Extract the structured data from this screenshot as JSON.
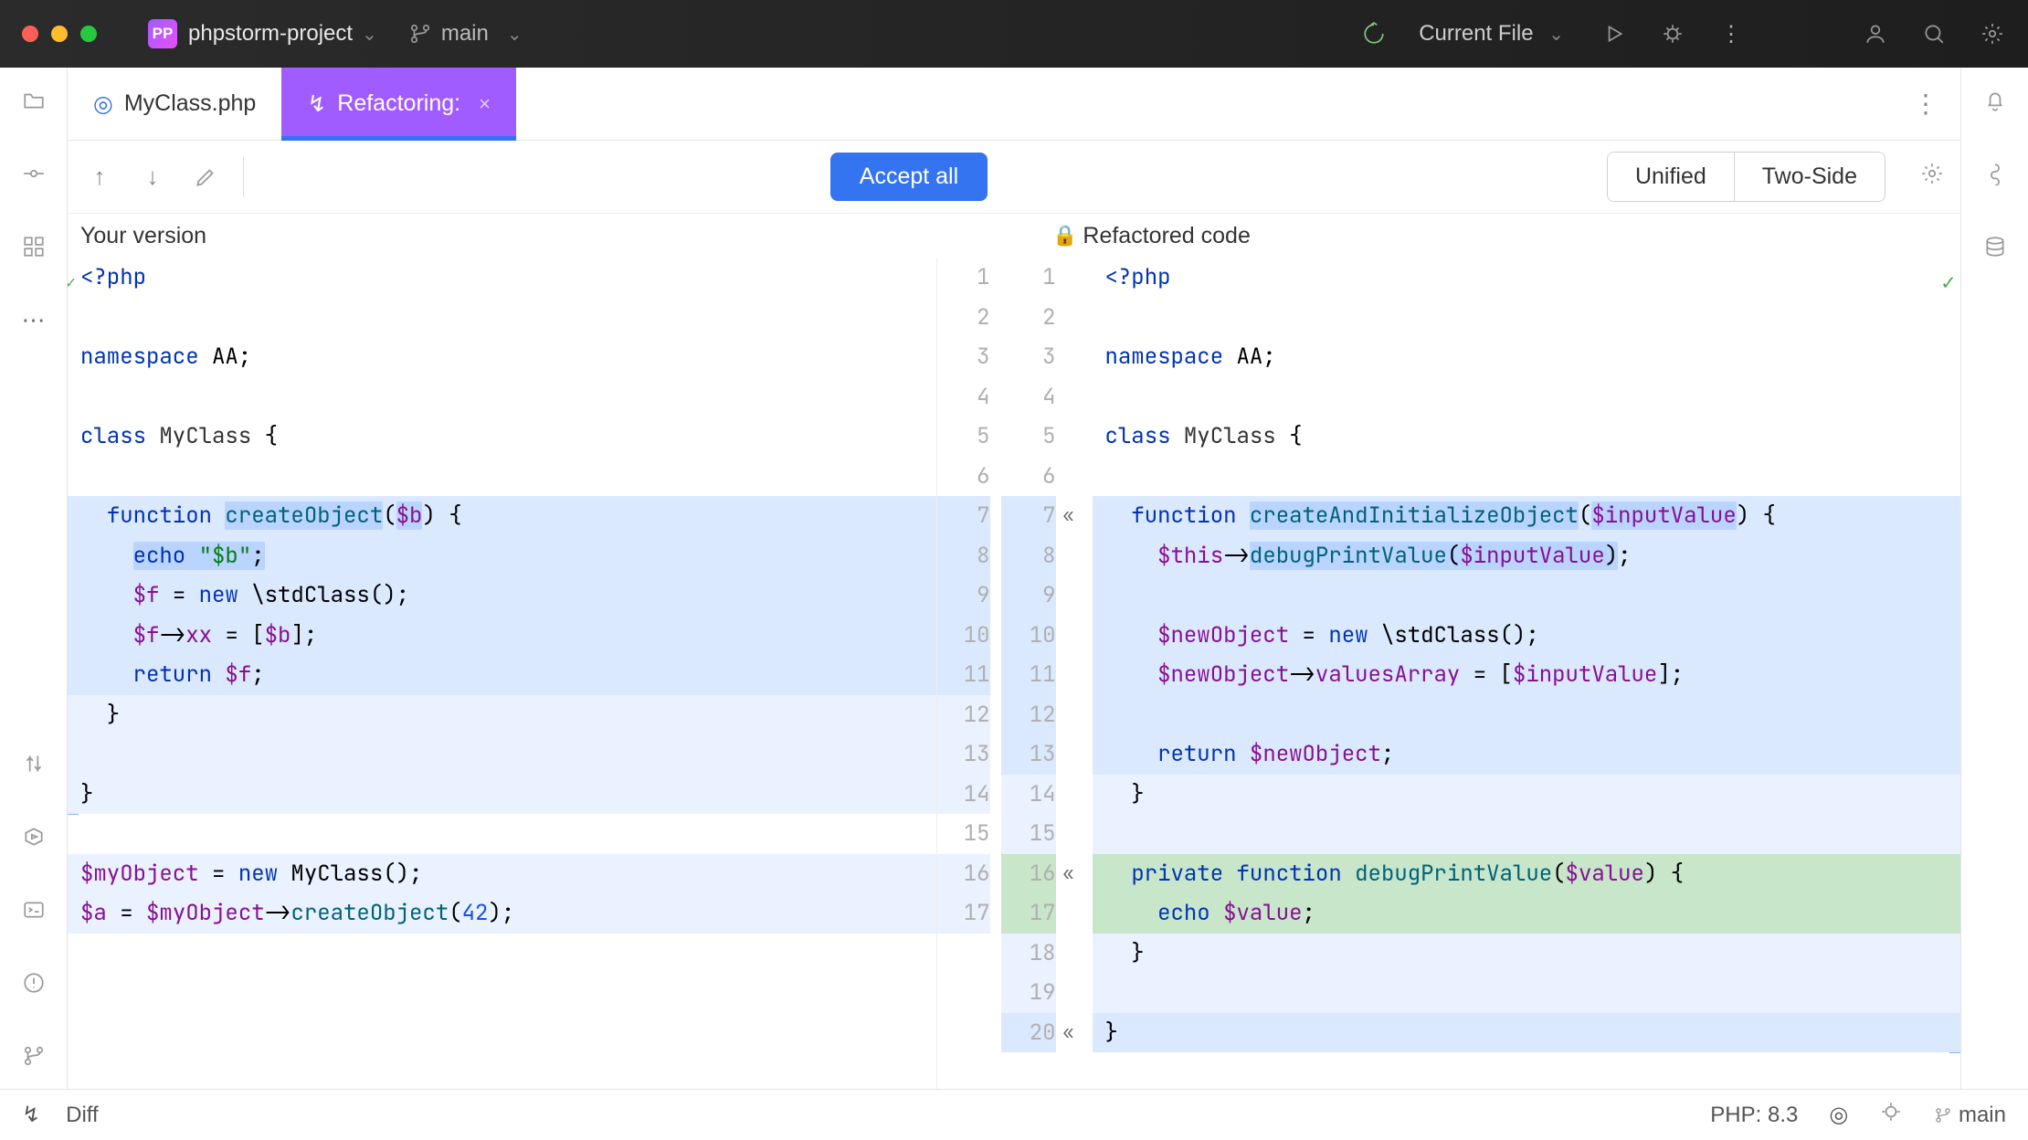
{
  "titlebar": {
    "project_name": "phpstorm-project",
    "branch_name": "main",
    "current_file_label": "Current File"
  },
  "tabs": {
    "file_tab": "MyClass.php",
    "refactor_tab": "Refactoring:"
  },
  "toolbar": {
    "accept_label": "Accept all",
    "view_unified": "Unified",
    "view_twoside": "Two-Side"
  },
  "diff_headers": {
    "left": "Your version",
    "right": "Refactored code"
  },
  "gutters_left": [
    "1",
    "2",
    "3",
    "4",
    "5",
    "6",
    "7",
    "8",
    "9",
    "10",
    "11",
    "12",
    "13",
    "14",
    "15",
    "16",
    "17"
  ],
  "gutters_right": [
    "1",
    "2",
    "3",
    "4",
    "5",
    "6",
    "7",
    "8",
    "9",
    "10",
    "11",
    "12",
    "13",
    "14",
    "15",
    "16",
    "17",
    "18",
    "19",
    "20"
  ],
  "left_code": [
    {
      "t": "<?php",
      "cls": "tag"
    },
    {
      "t": ""
    },
    {
      "t": "namespace AA;",
      "ns": true
    },
    {
      "t": ""
    },
    {
      "t": "class MyClass {",
      "classdecl": true
    },
    {
      "t": ""
    },
    {
      "t": "  function createObject($b) {",
      "hl": "blue",
      "fn": "createObject",
      "args": "$b",
      "w1": "createObject",
      "w2": "$b"
    },
    {
      "t": "    echo \"$b\";",
      "hl": "blue",
      "echo": true,
      "wordfull": true
    },
    {
      "t": "    $f = new \\stdClass();",
      "hl": "blue",
      "var1": "$f"
    },
    {
      "t": "    $f->xx = [$b];",
      "hl": "blue",
      "var1": "$f",
      "prop": "xx",
      "arr": "$b"
    },
    {
      "t": "    return $f;",
      "hl": "blue",
      "var1": "$f"
    },
    {
      "t": "  }",
      "hl": "lite"
    },
    {
      "t": "",
      "hl": "lite"
    },
    {
      "t": "}",
      "hl": "lite"
    },
    {
      "t": ""
    },
    {
      "t": "$myObject = new MyClass();",
      "hl": "lite",
      "var1": "$myObject"
    },
    {
      "t": "$a = $myObject->createObject(42);",
      "hl": "lite",
      "var1": "$a",
      "var2": "$myObject",
      "fn": "createObject",
      "num": "42"
    }
  ],
  "right_code": [
    {
      "t": "<?php",
      "cls": "tag"
    },
    {
      "t": ""
    },
    {
      "t": "namespace AA;",
      "ns": true
    },
    {
      "t": ""
    },
    {
      "t": "class MyClass {",
      "classdecl": true
    },
    {
      "t": ""
    },
    {
      "t": "  function createAndInitializeObject($inputValue) {",
      "hl": "blue",
      "fn": "createAndInitializeObject",
      "args": "$inputValue",
      "w1": "createAndInitializeObject",
      "w2": "$inputValue"
    },
    {
      "t": "    $this->debugPrintValue($inputValue);",
      "hl": "blue",
      "thiscall": true
    },
    {
      "t": "",
      "hl": "blue"
    },
    {
      "t": "    $newObject = new \\stdClass();",
      "hl": "blue",
      "var1": "$newObject"
    },
    {
      "t": "    $newObject->valuesArray = [$inputValue];",
      "hl": "blue",
      "var1": "$newObject",
      "prop": "valuesArray",
      "arr": "$inputValue"
    },
    {
      "t": "",
      "hl": "blue"
    },
    {
      "t": "    return $newObject;",
      "hl": "blue",
      "var1": "$newObject"
    },
    {
      "t": "  }",
      "hl": "lite"
    },
    {
      "t": "",
      "hl": "lite"
    },
    {
      "t": "  private function debugPrintValue($value) {",
      "hl": "green",
      "priv": true,
      "fn": "debugPrintValue",
      "args": "$value"
    },
    {
      "t": "    echo $value;",
      "hl": "green",
      "var1": "$value"
    },
    {
      "t": "  }",
      "hl": "lite"
    },
    {
      "t": "",
      "hl": "lite"
    },
    {
      "t": "}",
      "hl": "blue"
    }
  ],
  "expand_markers": {
    "7": true,
    "16": true,
    "20": true
  },
  "statusbar": {
    "diff_label": "Diff",
    "php_version": "PHP: 8.3",
    "branch": "main"
  }
}
